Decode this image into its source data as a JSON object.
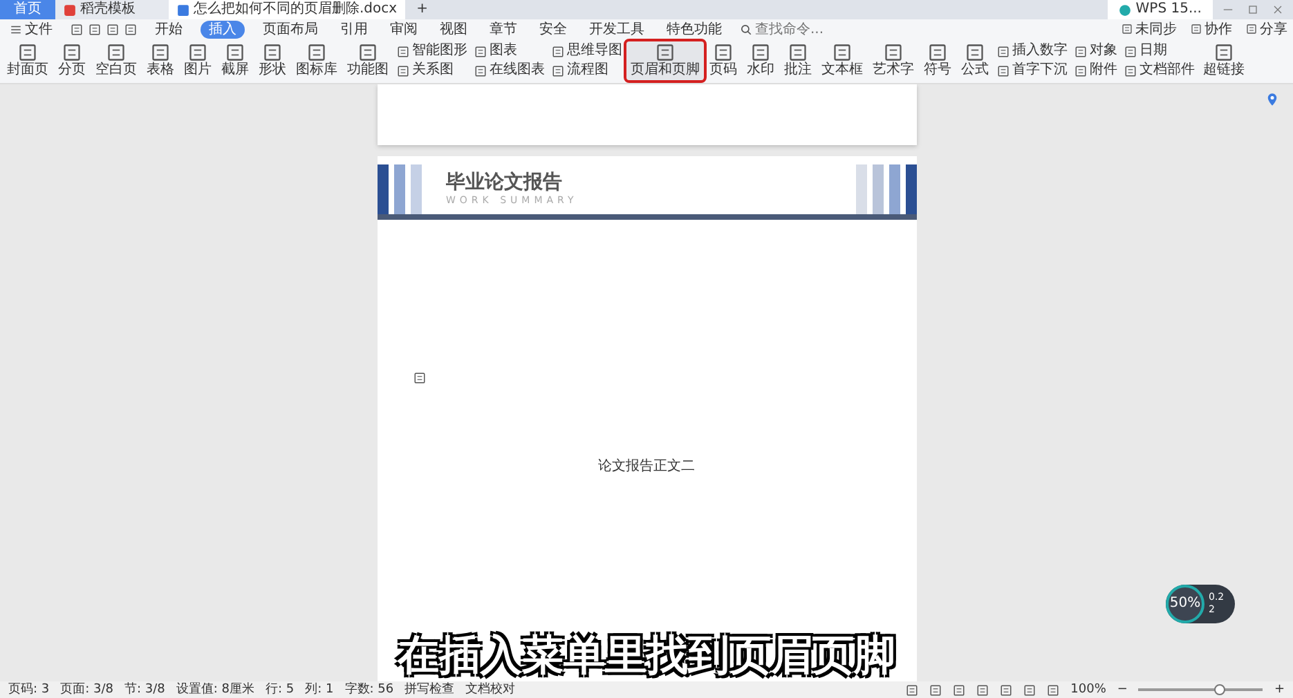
{
  "title_bar": {
    "tabs": [
      {
        "label": "首页",
        "kind": "home",
        "selected": false
      },
      {
        "label": "稻壳模板",
        "kind": "app",
        "selected": false
      },
      {
        "label": "怎么把如何不同的页眉删除.docx",
        "kind": "doc",
        "selected": true
      }
    ],
    "new_tab": "+",
    "account": "WPS 15..."
  },
  "menu": {
    "file": "文件",
    "items": [
      {
        "label": "开始",
        "selected": false
      },
      {
        "label": "插入",
        "selected": true
      },
      {
        "label": "页面布局",
        "selected": false
      },
      {
        "label": "引用",
        "selected": false
      },
      {
        "label": "审阅",
        "selected": false
      },
      {
        "label": "视图",
        "selected": false
      },
      {
        "label": "章节",
        "selected": false
      },
      {
        "label": "安全",
        "selected": false
      },
      {
        "label": "开发工具",
        "selected": false
      },
      {
        "label": "特色功能",
        "selected": false
      }
    ],
    "search": {
      "placeholder": "查找命令..."
    },
    "actions": [
      "未同步",
      "协作",
      "分享"
    ]
  },
  "ribbon": [
    {
      "kind": "large",
      "label": "封面页",
      "highlighted": false
    },
    {
      "kind": "large",
      "label": "分页",
      "highlighted": false
    },
    {
      "kind": "large",
      "label": "空白页",
      "highlighted": false
    },
    {
      "kind": "large",
      "label": "表格",
      "highlighted": false
    },
    {
      "kind": "large",
      "label": "图片",
      "highlighted": false
    },
    {
      "kind": "large",
      "label": "截屏",
      "highlighted": false
    },
    {
      "kind": "large",
      "label": "形状",
      "highlighted": false
    },
    {
      "kind": "large",
      "label": "图标库",
      "highlighted": false
    },
    {
      "kind": "large",
      "label": "功能图",
      "highlighted": false
    },
    {
      "kind": "pair",
      "items": [
        "智能图形",
        "关系图"
      ]
    },
    {
      "kind": "pair",
      "items": [
        "图表",
        "在线图表"
      ]
    },
    {
      "kind": "pair",
      "items": [
        "思维导图",
        "流程图"
      ]
    },
    {
      "kind": "large",
      "label": "页眉和页脚",
      "highlighted": true
    },
    {
      "kind": "large",
      "label": "页码",
      "highlighted": false
    },
    {
      "kind": "large",
      "label": "水印",
      "highlighted": false
    },
    {
      "kind": "large",
      "label": "批注",
      "highlighted": false
    },
    {
      "kind": "large",
      "label": "文本框",
      "highlighted": false
    },
    {
      "kind": "large",
      "label": "艺术字",
      "highlighted": false
    },
    {
      "kind": "large",
      "label": "符号",
      "highlighted": false
    },
    {
      "kind": "large",
      "label": "公式",
      "highlighted": false
    },
    {
      "kind": "pair",
      "items": [
        "插入数字",
        "首字下沉"
      ]
    },
    {
      "kind": "pair",
      "items": [
        "对象",
        "附件"
      ]
    },
    {
      "kind": "pair",
      "items": [
        "日期",
        "文档部件"
      ]
    },
    {
      "kind": "large",
      "label": "超链接",
      "highlighted": false
    }
  ],
  "document": {
    "header_title": "毕业论文报告",
    "header_subtitle": "WORK SUMMARY",
    "body_text": "论文报告正文二"
  },
  "status_bar": {
    "items": [
      "页码: 3",
      "页面: 3/8",
      "节: 3/8",
      "设置值: 8厘米",
      "行: 5",
      "列: 1",
      "字数: 56",
      "拼写检查",
      "文档校对"
    ],
    "zoom": "100%",
    "zoom_out": "−",
    "zoom_slider": {
      "level": 0.65
    },
    "zoom_in": "+"
  },
  "speed_widget": {
    "percent": "50%",
    "upload": "0.2",
    "download": "2"
  },
  "caption": "在插入菜单里找到页眉页脚"
}
